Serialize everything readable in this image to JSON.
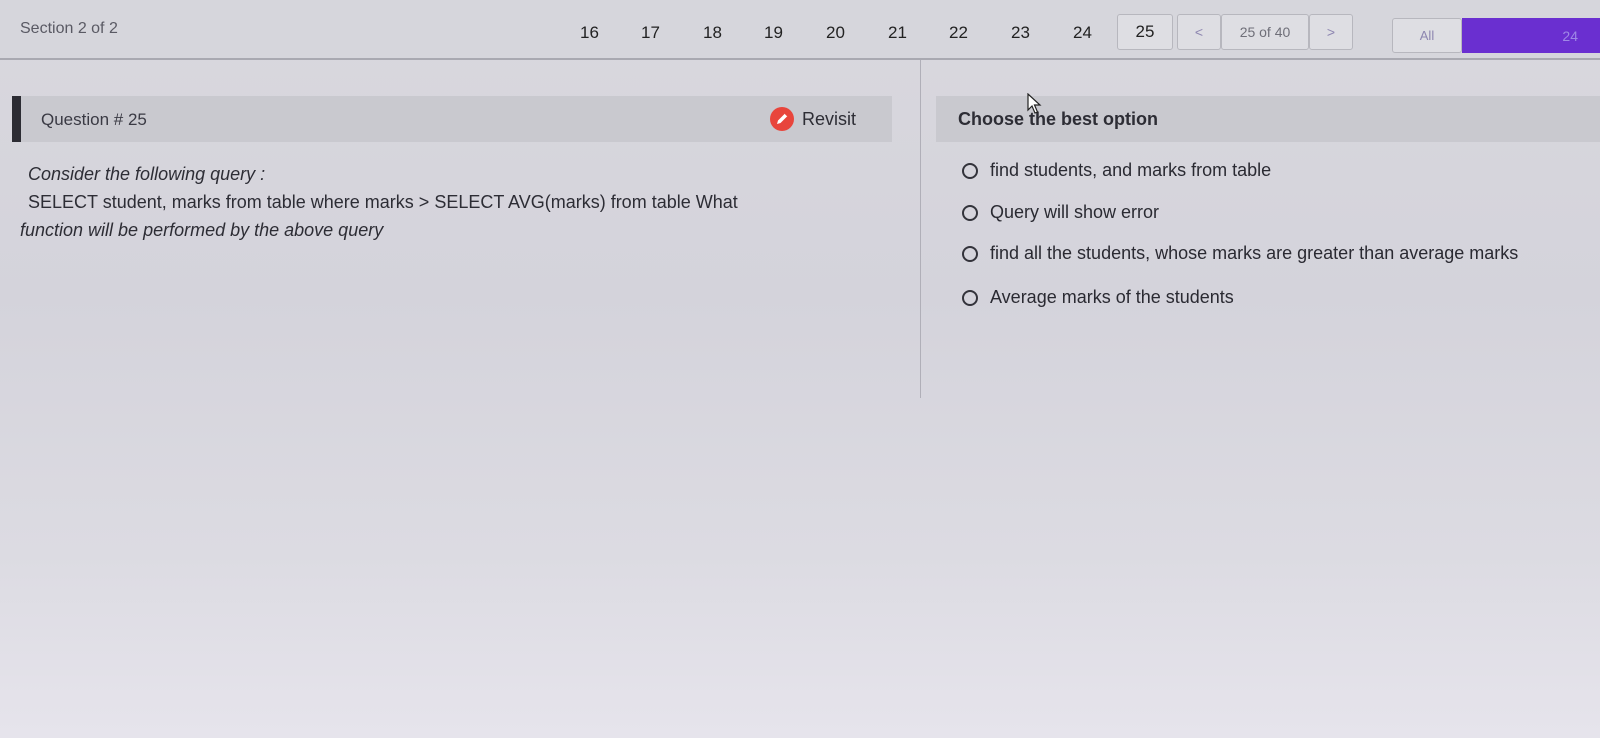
{
  "header": {
    "section_label": "Section 2 of 2",
    "question_numbers": [
      "16",
      "17",
      "18",
      "19",
      "20",
      "21",
      "22",
      "23",
      "24"
    ],
    "current_question": "25",
    "prev_arrow": "<",
    "position_text": "25 of 40",
    "next_arrow": ">",
    "filter_label": "All",
    "tab_count": "24"
  },
  "question": {
    "title": "Question # 25",
    "revisit_label": "Revisit",
    "revisit_icon": "edit-icon",
    "line1": "Consider the following query :",
    "line2": "SELECT student, marks from table where marks > SELECT AVG(marks) from table What",
    "line3": "function will be performed by the above query"
  },
  "options": {
    "title": "Choose the best option",
    "items": [
      "find students, and marks from table",
      "Query will show error",
      "find all the students, whose marks are greater than average marks",
      "Average marks of the students"
    ]
  },
  "colors": {
    "accent_purple": "#6a2fd0",
    "revisit_red": "#e8453c"
  }
}
